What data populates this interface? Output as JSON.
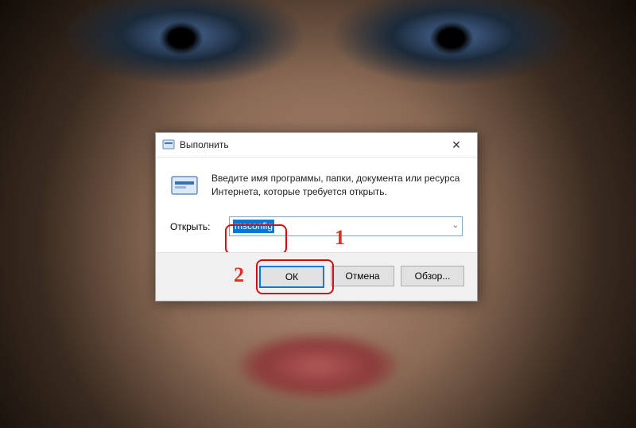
{
  "window": {
    "title": "Выполнить",
    "close_glyph": "✕"
  },
  "message": "Введите имя программы, папки, документа или ресурса Интернета, которые требуется открыть.",
  "open_label": "Открыть:",
  "input_value": "msconfig",
  "buttons": {
    "ok": "ОК",
    "cancel": "Отмена",
    "browse": "Обзор..."
  },
  "annotations": {
    "marker1": "1",
    "marker2": "2"
  },
  "icons": {
    "run_small": "run-icon",
    "run_large": "run-icon",
    "dropdown": "chevron-down-icon"
  }
}
